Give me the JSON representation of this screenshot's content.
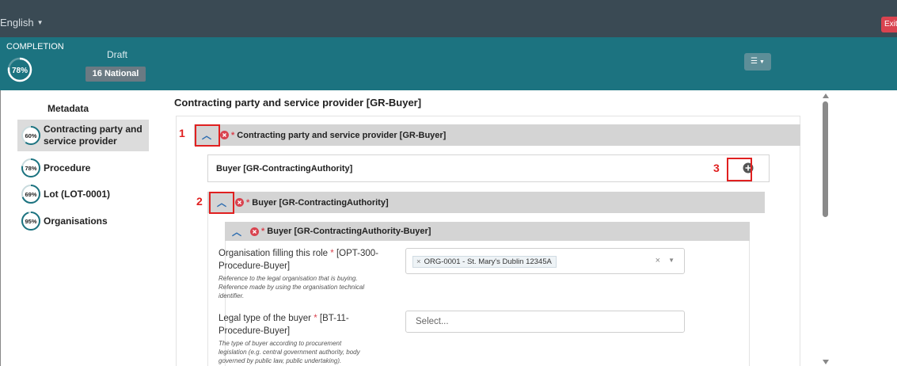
{
  "topbar": {
    "language": "English",
    "exit_label": "Exit"
  },
  "status": {
    "completion_label": "COMPLETION",
    "completion_percent": "78%",
    "completion_value": 78,
    "draft_label": "Draft",
    "national_badge": "16 National"
  },
  "sidebar": {
    "title": "Metadata",
    "items": [
      {
        "percent": "60%",
        "value": 60,
        "label_line1": "Contracting party and",
        "label_line2": "service provider"
      },
      {
        "percent": "78%",
        "value": 78,
        "label": "Procedure"
      },
      {
        "percent": "69%",
        "value": 69,
        "label": "Lot (LOT-0001)"
      },
      {
        "percent": "95%",
        "value": 95,
        "label": "Organisations"
      }
    ]
  },
  "main": {
    "title": "Contracting party and service provider [GR-Buyer]",
    "section1": {
      "required": "*",
      "label": "Contracting party and service provider  [GR-Buyer]"
    },
    "buyer_box": {
      "label": "Buyer  [GR-ContractingAuthority]"
    },
    "section2": {
      "required": "*",
      "label": "Buyer  [GR-ContractingAuthority]"
    },
    "section3": {
      "required": "*",
      "label": "Buyer  [GR-ContractingAuthority-Buyer]"
    },
    "field1": {
      "label_line1": "Organisation filling this role",
      "required": "*",
      "label_code1": "[OPT-300-",
      "label_line2": "Procedure-Buyer]",
      "help_line1": "Reference to the legal organisation that is buying.",
      "help_line2": "Reference made by using the organisation technical",
      "help_line3": "identifier.",
      "tag_remove": "×",
      "value": "ORG-0001 - St. Mary's Dublin 12345A",
      "clear": "×"
    },
    "field2": {
      "label_line1": "Legal type of the buyer",
      "required": "*",
      "label_code1": "[BT-11-",
      "label_line2": "Procedure-Buyer]",
      "help_line1": "The type of buyer according to procurement",
      "help_line2": "legislation (e.g. central government authority, body",
      "help_line3": "governed by public law, public undertaking).",
      "placeholder": "Select..."
    }
  },
  "annotations": [
    "1",
    "2",
    "3"
  ],
  "colors": {
    "topbar": "#3a4a54",
    "statusbar": "#1c7380",
    "accent_red": "#d9434f",
    "annotation_red": "#e02020",
    "chevron_blue": "#2b6cb0"
  }
}
